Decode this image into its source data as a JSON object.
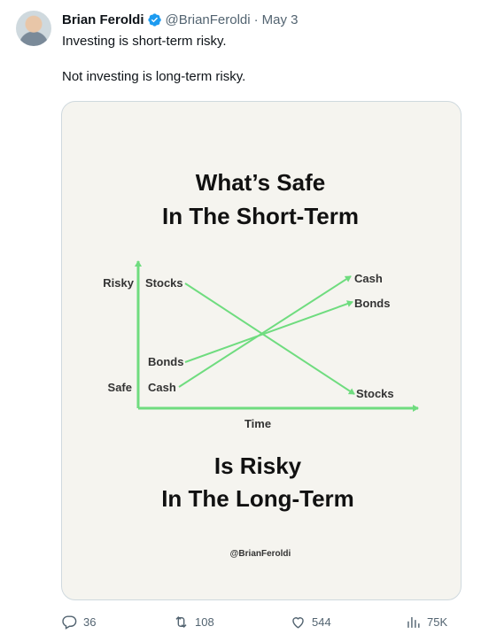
{
  "tweet": {
    "author_name": "Brian Feroldi",
    "author_handle": "@BrianFeroldi",
    "separator": "·",
    "date": "May 3",
    "text_line1": "Investing is short-term risky.",
    "text_line2": "Not investing is long-term risky."
  },
  "image": {
    "title_line1": "What’s Safe",
    "title_line2": "In The Short-Term",
    "y_label_top": "Risky",
    "y_label_bottom": "Safe",
    "x_label": "Time",
    "left_labels": [
      "Stocks",
      "Bonds",
      "Cash"
    ],
    "right_labels": [
      "Cash",
      "Bonds",
      "Stocks"
    ],
    "bottom_line1": "Is Risky",
    "bottom_line2": "In The Long-Term",
    "credit": "@BrianFeroldi",
    "accent_color": "#6fdc7f",
    "background_color": "#f5f4ef"
  },
  "actions": {
    "replies": "36",
    "reposts": "108",
    "likes": "544",
    "views": "75K"
  },
  "icons": [
    "verified-badge-icon",
    "reply-icon",
    "repost-icon",
    "like-icon",
    "views-icon"
  ]
}
